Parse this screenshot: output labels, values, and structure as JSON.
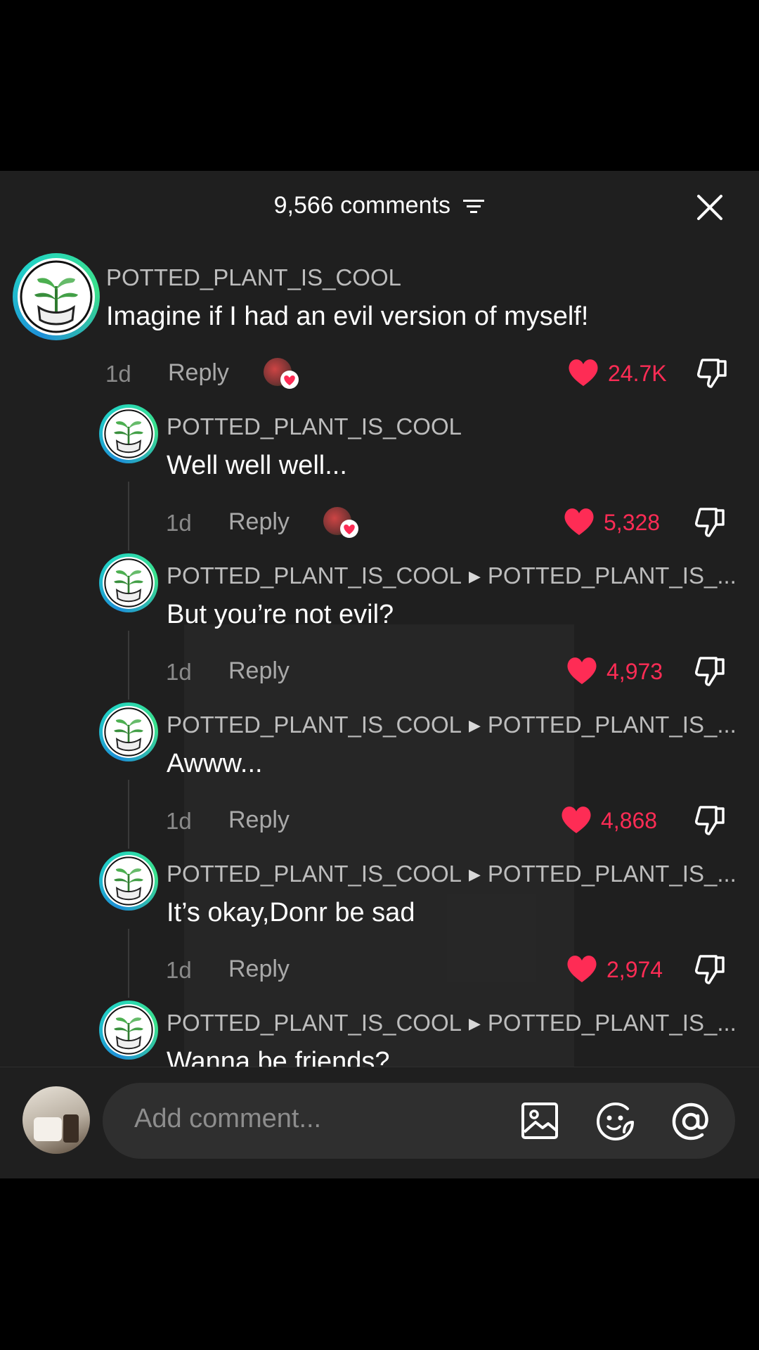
{
  "header": {
    "title": "9,566 comments"
  },
  "comments": [
    {
      "username": "POTTED_PLANT_IS_COOL",
      "reply_to": "",
      "text": "Imagine if I had an evil version of myself!",
      "time": "1d",
      "reply_label": "Reply",
      "likes": "24.7K"
    },
    {
      "username": "POTTED_PLANT_IS_COOL",
      "reply_to": "",
      "text": "Well well well...",
      "time": "1d",
      "reply_label": "Reply",
      "likes": "5,328"
    },
    {
      "username": "POTTED_PLANT_IS_COOL",
      "reply_to": "POTTED_PLANT_IS_...",
      "text": "But you’re not evil?",
      "time": "1d",
      "reply_label": "Reply",
      "likes": "4,973"
    },
    {
      "username": "POTTED_PLANT_IS_COOL",
      "reply_to": "POTTED_PLANT_IS_...",
      "text": "Awww...",
      "time": "1d",
      "reply_label": "Reply",
      "likes": "4,868"
    },
    {
      "username": "POTTED_PLANT_IS_COOL",
      "reply_to": "POTTED_PLANT_IS_...",
      "text": "It’s okay,Donr be sad",
      "time": "1d",
      "reply_label": "Reply",
      "likes": "2,974"
    },
    {
      "username": "POTTED_PLANT_IS_COOL",
      "reply_to": "POTTED_PLANT_IS_...",
      "text": "Wanna be friends?"
    }
  ],
  "composer": {
    "placeholder": "Add comment..."
  },
  "colors": {
    "like": "#fe2c55",
    "panel": "#1f1f1f",
    "ring": "#22d3c5"
  },
  "icons": [
    "filter-icon",
    "close-icon",
    "heart-icon",
    "dislike-icon",
    "image-icon",
    "emoji-icon",
    "mention-icon"
  ]
}
